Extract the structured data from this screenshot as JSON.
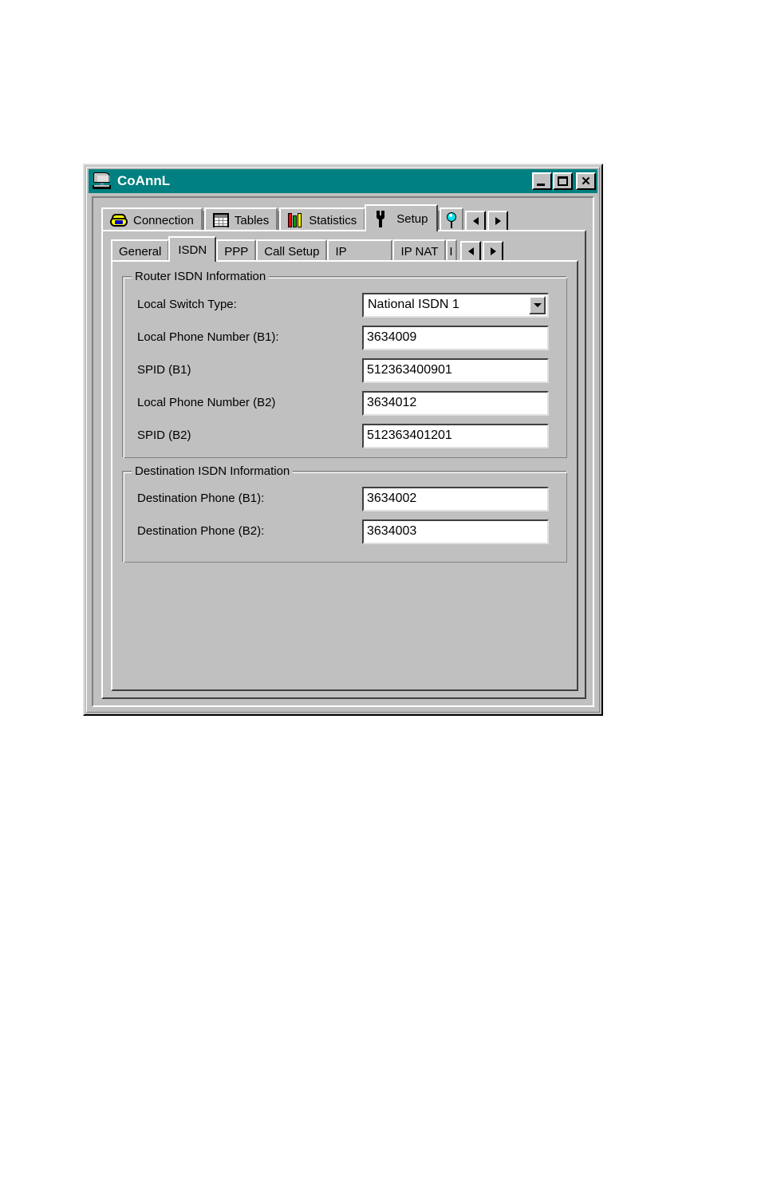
{
  "window": {
    "title": "CoAnnL",
    "icon": "computer-monitor-icon",
    "titlebar_color": "#008080",
    "face_color": "#c0c0c0",
    "buttons": {
      "minimize": "_",
      "maximize": "□",
      "close": "✕"
    }
  },
  "outer_tabs": {
    "items": [
      {
        "label": "Connection",
        "icon": "telephone-icon",
        "active": false
      },
      {
        "label": "Tables",
        "icon": "table-grid-icon",
        "active": false
      },
      {
        "label": "Statistics",
        "icon": "bar-chart-icon",
        "active": false
      },
      {
        "label": "Setup",
        "icon": "wrench-icon",
        "active": true
      }
    ],
    "overflow_icon": "pushpin-icon",
    "scroll_left": "◄",
    "scroll_right": "►"
  },
  "inner_tabs": {
    "items": [
      {
        "label": "General",
        "active": false
      },
      {
        "label": "ISDN",
        "active": true
      },
      {
        "label": "PPP",
        "active": false
      },
      {
        "label": "Call Setup",
        "active": false
      },
      {
        "label": "IP",
        "active": false
      },
      {
        "label": "IP NAT",
        "active": false
      },
      {
        "label": "I",
        "active": false
      }
    ],
    "scroll_left": "◄",
    "scroll_right": "►"
  },
  "router_group": {
    "title": "Router ISDN Information",
    "fields": [
      {
        "label": "Local Switch Type:",
        "value": "National ISDN 1",
        "type": "combobox"
      },
      {
        "label": "Local Phone Number (B1):",
        "value": "3634009",
        "type": "textbox"
      },
      {
        "label": "SPID (B1)",
        "value": "512363400901",
        "type": "textbox"
      },
      {
        "label": "Local Phone Number (B2)",
        "value": "3634012",
        "type": "textbox"
      },
      {
        "label": "SPID (B2)",
        "value": "512363401201",
        "type": "textbox"
      }
    ]
  },
  "destination_group": {
    "title": "Destination ISDN Information",
    "fields": [
      {
        "label": "Destination Phone (B1):",
        "value": "3634002",
        "type": "textbox"
      },
      {
        "label": "Destination Phone (B2):",
        "value": "3634003",
        "type": "textbox"
      }
    ]
  }
}
